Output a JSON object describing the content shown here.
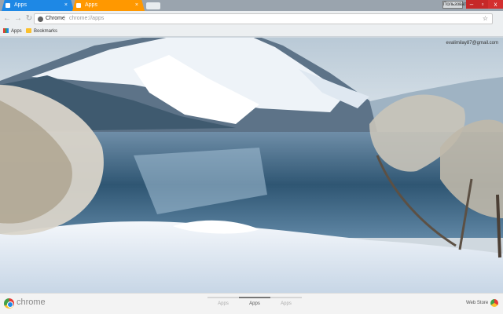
{
  "tabs": [
    {
      "label": "Apps",
      "color": "#1e88e5"
    },
    {
      "label": "Apps",
      "color": "#ff9800"
    }
  ],
  "window": {
    "user_label": "Пользователь",
    "min": "–",
    "max": "▫",
    "close": "x"
  },
  "toolbar": {
    "back": "←",
    "forward": "→",
    "reload": "↻",
    "site_label": "Chrome",
    "separator": "|",
    "url": "chrome://apps",
    "star": "☆"
  },
  "bookmarks": [
    {
      "label": "Apps"
    },
    {
      "label": "Bookmarks"
    }
  ],
  "account": {
    "email": "evalimilay87@gmail.com"
  },
  "footer": {
    "brand": "chrome",
    "pages": [
      "Apps",
      "Apps",
      "Apps"
    ],
    "active_page": 1,
    "webstore": "Web Store"
  }
}
